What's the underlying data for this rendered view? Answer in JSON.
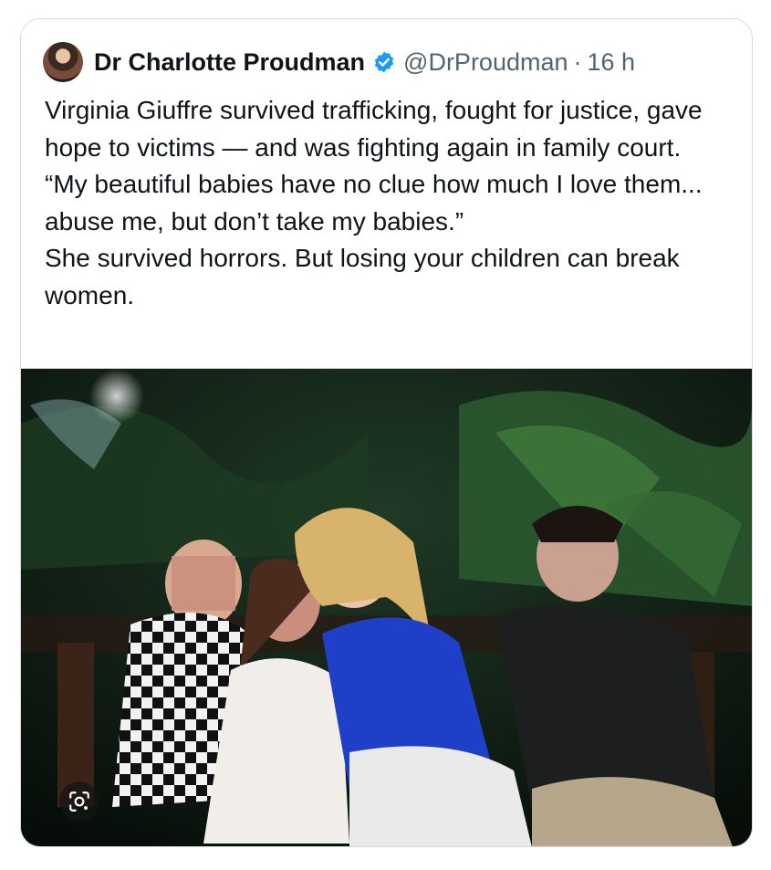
{
  "tweet": {
    "author_name": "Dr Charlotte Proudman",
    "handle": "@DrProudman",
    "separator": "·",
    "time": "16 h",
    "text_lines": [
      "Virginia Giuffre survived trafficking, fought for justice, gave hope to victims — and was fighting again in family court.",
      "“My beautiful babies have no clue how much I love them... abuse me, but don’t take my babies.”",
      "She survived horrors. But losing your children can break women."
    ]
  },
  "icons": {
    "avatar": "author-avatar",
    "verified": "verified-badge-icon",
    "lens": "google-lens-icon"
  },
  "colors": {
    "verified_blue": "#1d9bf0",
    "text_primary": "#0f1419",
    "text_secondary": "#536471"
  }
}
